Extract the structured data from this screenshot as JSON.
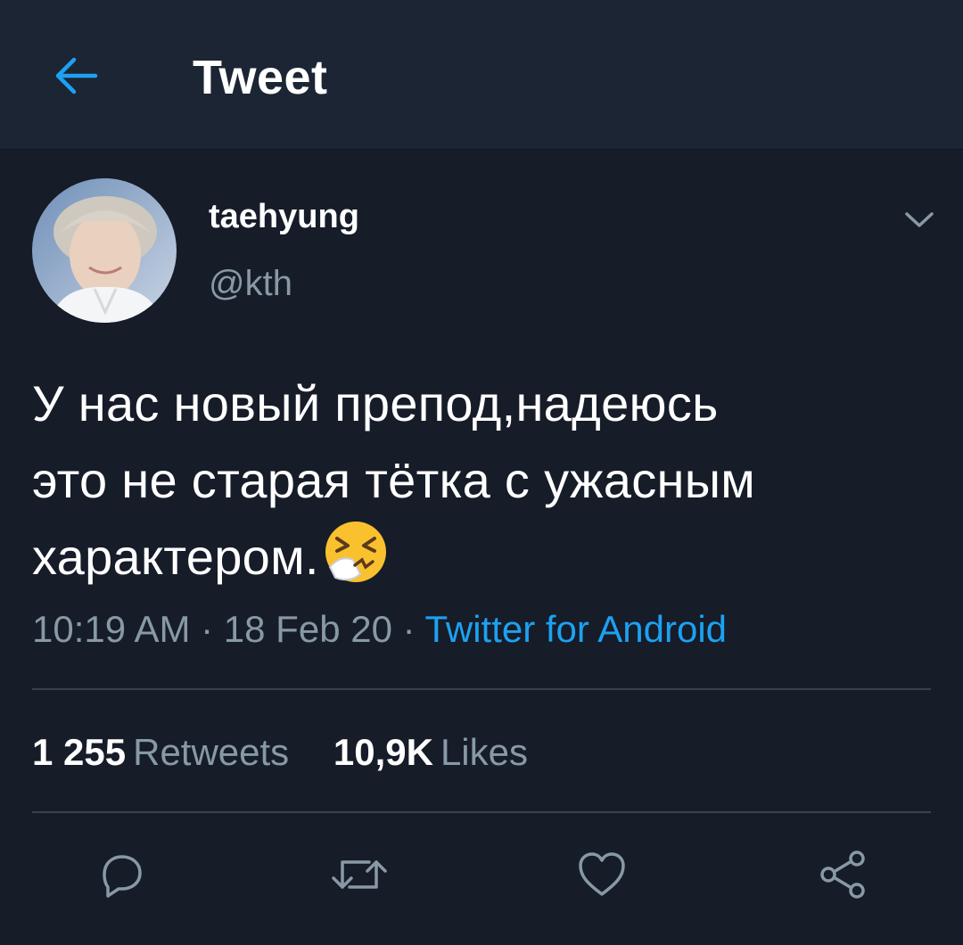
{
  "header": {
    "title": "Tweet",
    "back_icon": "arrow-left-icon"
  },
  "tweet": {
    "author": {
      "display_name": "taehyung",
      "handle": "@kth"
    },
    "text_lines": [
      "У нас новый препод,надеюсь",
      "это не старая тётка с ужасным",
      "характером."
    ],
    "emoji": "sneezing-face-emoji",
    "meta": {
      "time": "10:19 AM",
      "separator": " · ",
      "date": "18 Feb 20",
      "source": "Twitter for Android"
    },
    "stats": {
      "retweets_count": "1 255",
      "retweets_label": "Retweets",
      "likes_count": "10,9K",
      "likes_label": "Likes"
    },
    "actions": [
      "reply-icon",
      "retweet-icon",
      "like-icon",
      "share-icon"
    ]
  },
  "colors": {
    "background": "#161c28",
    "header_background": "#1c2534",
    "accent": "#1da1f2",
    "secondary_text": "#8899a6",
    "divider": "#38444d"
  }
}
